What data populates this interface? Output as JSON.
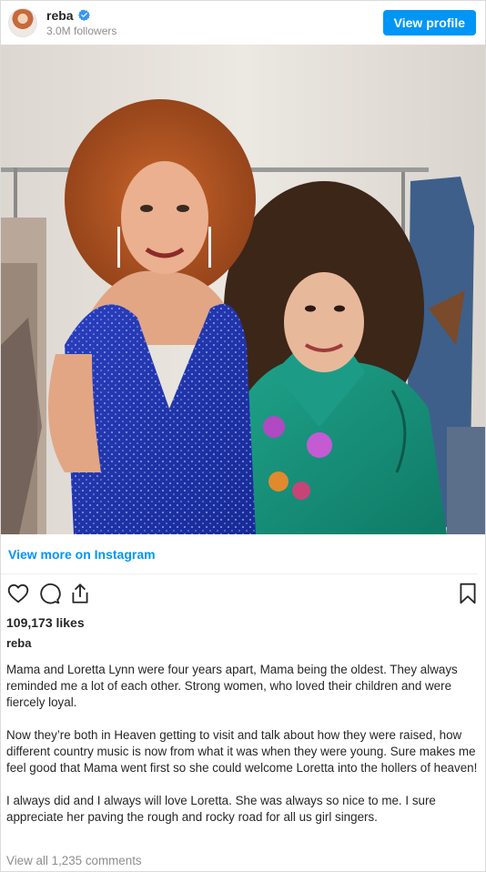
{
  "header": {
    "username": "reba",
    "followers": "3.0M followers",
    "view_profile_label": "View profile",
    "avatar_icon": "user-avatar",
    "verified_icon": "verified-badge-icon"
  },
  "photo": {
    "description_icon": "post-photo"
  },
  "view_more_label": "View more on Instagram",
  "actions": {
    "like_icon": "heart-icon",
    "comment_icon": "comment-icon",
    "share_icon": "share-icon",
    "save_icon": "bookmark-icon"
  },
  "likes": "109,173 likes",
  "caption_username": "reba",
  "caption_paragraphs": [
    "Mama and Loretta Lynn were four years apart, Mama being the oldest. They always reminded me a lot of each other. Strong women, who loved their children and were fiercely loyal.",
    "Now they’re both in Heaven getting to visit and talk about how they were raised, how different country music is now from what it was when they were young. Sure makes me feel good that Mama went first so she could welcome Loretta into the hollers of heaven!",
    "I always did and I always will love Loretta. She was always so nice to me. I sure appreciate her paving the rough and rocky road for all us girl singers."
  ],
  "comments_link": "View all 1,235 comments",
  "colors": {
    "accent": "#0095f6",
    "text": "#262626",
    "muted": "#8e8e8e"
  }
}
